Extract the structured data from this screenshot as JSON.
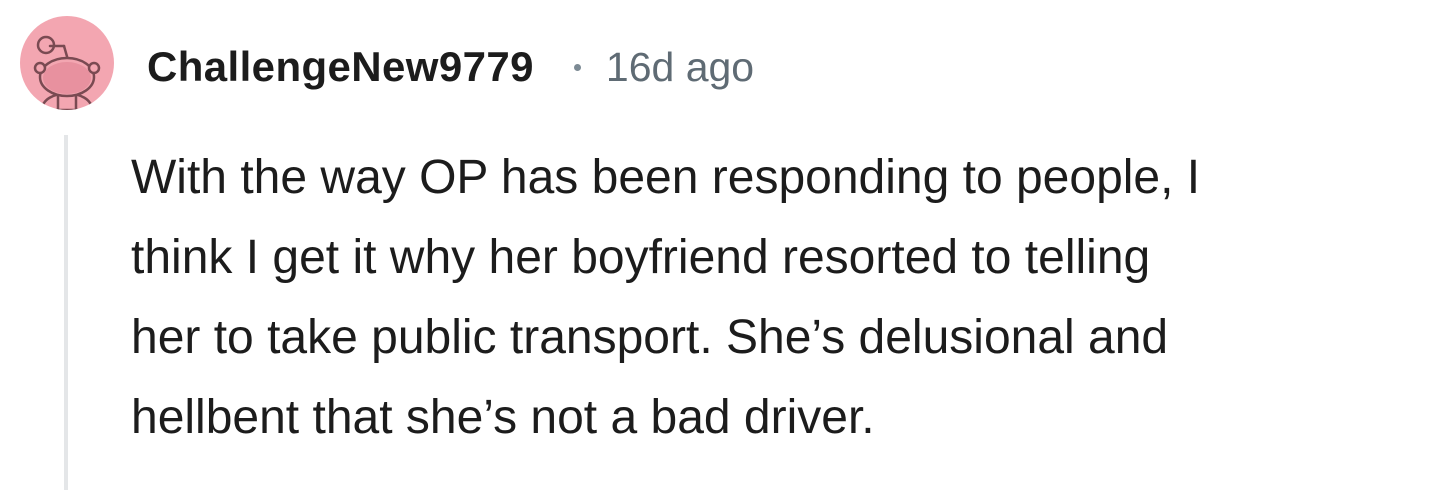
{
  "comment": {
    "avatar_icon": "reddit-snoo-avatar-icon",
    "avatar_color": "#f3a6b1",
    "username": "ChallengeNew9779",
    "separator": "•",
    "timestamp": "16d ago",
    "body_lines": [
      "With the way OP has been responding to people, I",
      "think I get it why her boyfriend resorted to telling",
      "her to take public transport. She’s delusional and",
      "hellbent that she’s not a bad driver."
    ]
  }
}
